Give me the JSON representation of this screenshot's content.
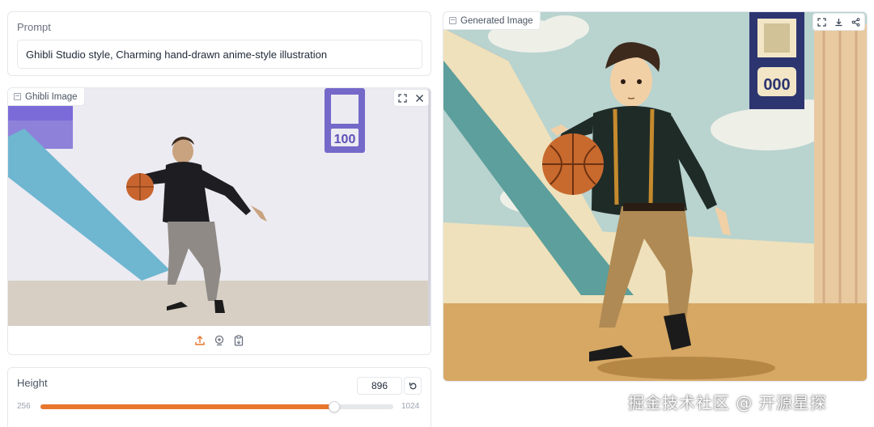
{
  "prompt": {
    "label": "Prompt",
    "value": "Ghibli Studio style, Charming hand-drawn anime-style illustration"
  },
  "input_image": {
    "label": "Ghibli Image",
    "scoreboard_number": "100",
    "tools": [
      "fullscreen-icon",
      "close-icon"
    ],
    "upload_actions": [
      "upload-icon",
      "webcam-icon",
      "clipboard-icon"
    ]
  },
  "height": {
    "label": "Height",
    "value": "896",
    "min": "256",
    "max": "1024",
    "fraction": 0.833
  },
  "output_image": {
    "label": "Generated Image",
    "scoreboard_number": "000",
    "tools": [
      "fullscreen-icon",
      "download-icon",
      "share-icon"
    ]
  },
  "watermark": "掘金技术社区 @ 开源星探",
  "colors": {
    "accent": "#e8762d",
    "border": "#e5e7eb"
  }
}
